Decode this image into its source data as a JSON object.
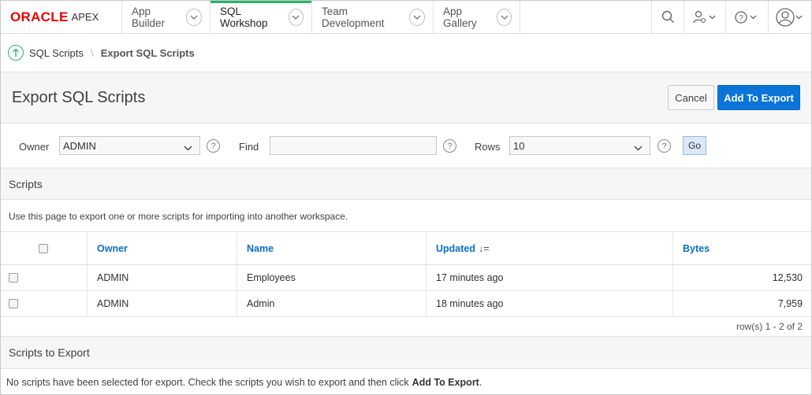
{
  "brand": {
    "oracle": "ORACLE",
    "apex": "APEX",
    "oracle_color": "#ee0000",
    "accent": "#2bb36a"
  },
  "nav": {
    "tabs": [
      {
        "label": "App Builder",
        "active": false
      },
      {
        "label": "SQL Workshop",
        "active": true
      },
      {
        "label": "Team Development",
        "active": false
      },
      {
        "label": "App Gallery",
        "active": false
      }
    ],
    "icons": [
      "search-icon",
      "user-admin-icon",
      "help-icon",
      "user-account-icon"
    ]
  },
  "breadcrumb": {
    "parent": "SQL Scripts",
    "separator": "\\",
    "current": "Export SQL Scripts"
  },
  "header": {
    "title": "Export SQL Scripts",
    "cancel_label": "Cancel",
    "add_label": "Add To Export",
    "primary_color": "#0b74d8"
  },
  "filters": {
    "owner_label": "Owner",
    "owner_value": "ADMIN",
    "find_label": "Find",
    "find_value": "",
    "rows_label": "Rows",
    "rows_value": "10",
    "go_label": "Go",
    "help_glyph": "?"
  },
  "scripts_region": {
    "title": "Scripts",
    "description": "Use this page to export one or more scripts for importing into another workspace.",
    "columns": [
      "Owner",
      "Name",
      "Updated",
      "Bytes"
    ],
    "sort_indicator": "↓=",
    "rows": [
      {
        "owner": "ADMIN",
        "name": "Employees",
        "updated": "17 minutes ago",
        "bytes": "12,530"
      },
      {
        "owner": "ADMIN",
        "name": "Admin",
        "updated": "18 minutes ago",
        "bytes": "7,959"
      }
    ],
    "pagination": "row(s) 1 - 2 of 2"
  },
  "export_region": {
    "title": "Scripts to Export",
    "message": "No scripts have been selected for export. Check the scripts you wish to export and then click",
    "message_action": "Add To Export",
    "message_end": "."
  }
}
